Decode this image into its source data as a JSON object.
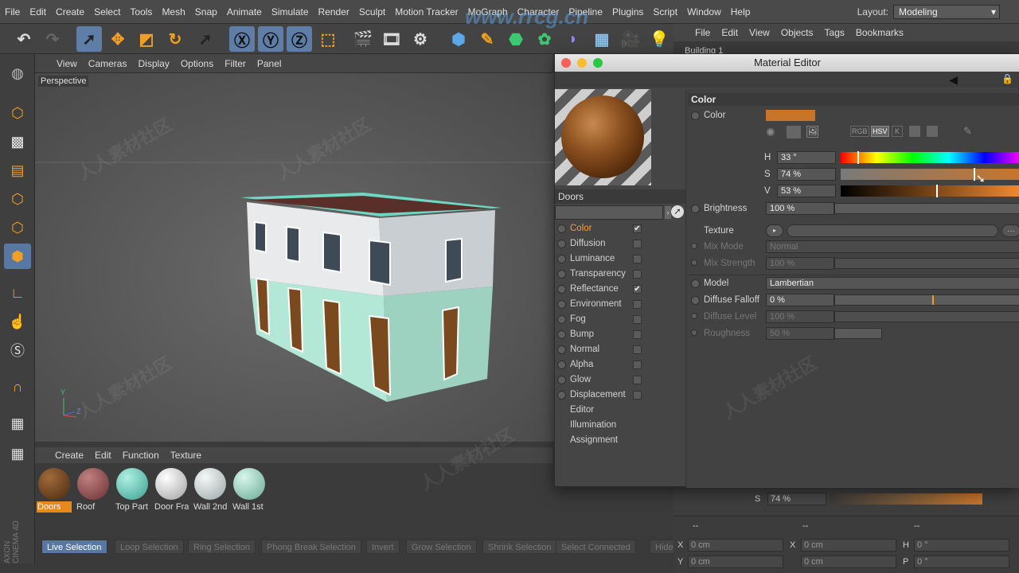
{
  "app": {
    "menus": [
      "File",
      "Edit",
      "Create",
      "Select",
      "Tools",
      "Mesh",
      "Snap",
      "Animate",
      "Simulate",
      "Render",
      "Sculpt",
      "Motion Tracker",
      "MoGraph",
      "Character",
      "Pipeline",
      "Plugins",
      "Script",
      "Window",
      "Help"
    ],
    "layout_label": "Layout:",
    "layout_value": "Modeling",
    "side_brand": "AXON CINEMA 4D"
  },
  "objects_panel": {
    "menus": [
      "File",
      "Edit",
      "View",
      "Objects",
      "Tags",
      "Bookmarks"
    ],
    "first_object": "Building 1"
  },
  "viewport": {
    "menus": [
      "View",
      "Cameras",
      "Display",
      "Options",
      "Filter",
      "Panel"
    ],
    "label": "Perspective",
    "axis_y": "Y",
    "axis_z": "Z"
  },
  "material_manager": {
    "menus": [
      "Create",
      "Edit",
      "Function",
      "Texture"
    ],
    "materials": [
      {
        "name": "Doors",
        "color": "#6e4522"
      },
      {
        "name": "Roof",
        "color": "#8a4a4a"
      },
      {
        "name": "Top Part",
        "color": "#6fd0be"
      },
      {
        "name": "Door Frame",
        "color": "#e8e8e8"
      },
      {
        "name": "Wall 2nd",
        "color": "#dde2e2"
      },
      {
        "name": "Wall 1st",
        "color": "#a6dcc8"
      }
    ]
  },
  "bottom_bar": {
    "modes": [
      "Live Selection",
      "Loop Selection",
      "Ring Selection",
      "Phong Break Selection",
      "Invert",
      "Grow Selection",
      "Shrink Selection",
      "Select Connected",
      "Hide"
    ]
  },
  "coords": {
    "x_label": "X",
    "x_value": "0 cm",
    "y_label": "Y",
    "y_value": "0 cm",
    "x2_label": "X",
    "x2_value": "0 cm",
    "x3_value": "0 cm",
    "h_label": "H",
    "h_value": "0 °",
    "p_label": "P",
    "p_value": "0 °",
    "dash": "--"
  },
  "attr_behind": {
    "s_label": "S",
    "s_value": "74 %"
  },
  "material_editor": {
    "title": "Material Editor",
    "material_name": "Doors",
    "channels": [
      {
        "label": "Color",
        "checked": true,
        "selected": true
      },
      {
        "label": "Diffusion",
        "checked": false
      },
      {
        "label": "Luminance",
        "checked": false
      },
      {
        "label": "Transparency",
        "checked": false
      },
      {
        "label": "Reflectance",
        "checked": true
      },
      {
        "label": "Environment",
        "checked": false
      },
      {
        "label": "Fog",
        "checked": false
      },
      {
        "label": "Bump",
        "checked": false
      },
      {
        "label": "Normal",
        "checked": false
      },
      {
        "label": "Alpha",
        "checked": false
      },
      {
        "label": "Glow",
        "checked": false
      },
      {
        "label": "Displacement",
        "checked": false
      }
    ],
    "extra_pages": [
      "Editor",
      "Illumination",
      "Assignment"
    ],
    "section_title": "Color",
    "color_label": "Color",
    "color_swatch": "#c8752a",
    "mode_buttons": [
      "RGB",
      "HSV",
      "K"
    ],
    "h_label": "H",
    "h_value": "33 °",
    "s_label": "S",
    "s_value": "74 %",
    "v_label": "V",
    "v_value": "53 %",
    "saturation_fraction": 0.74,
    "value_fraction": 0.53,
    "hue_degrees": 33,
    "brightness_label": "Brightness",
    "brightness_value": "100 %",
    "texture_label": "Texture",
    "mix_mode_label": "Mix Mode",
    "mix_mode_value": "Normal",
    "mix_strength_label": "Mix Strength",
    "mix_strength_value": "100 %",
    "model_label": "Model",
    "model_value": "Lambertian",
    "diffuse_falloff_label": "Diffuse Falloff",
    "diffuse_falloff_value": "0 %",
    "diffuse_level_label": "Diffuse Level",
    "diffuse_level_value": "100 %",
    "roughness_label": "Roughness",
    "roughness_value": "50 %"
  },
  "watermark": "人人素材社区",
  "url_watermark": "www.rrcg.cn"
}
